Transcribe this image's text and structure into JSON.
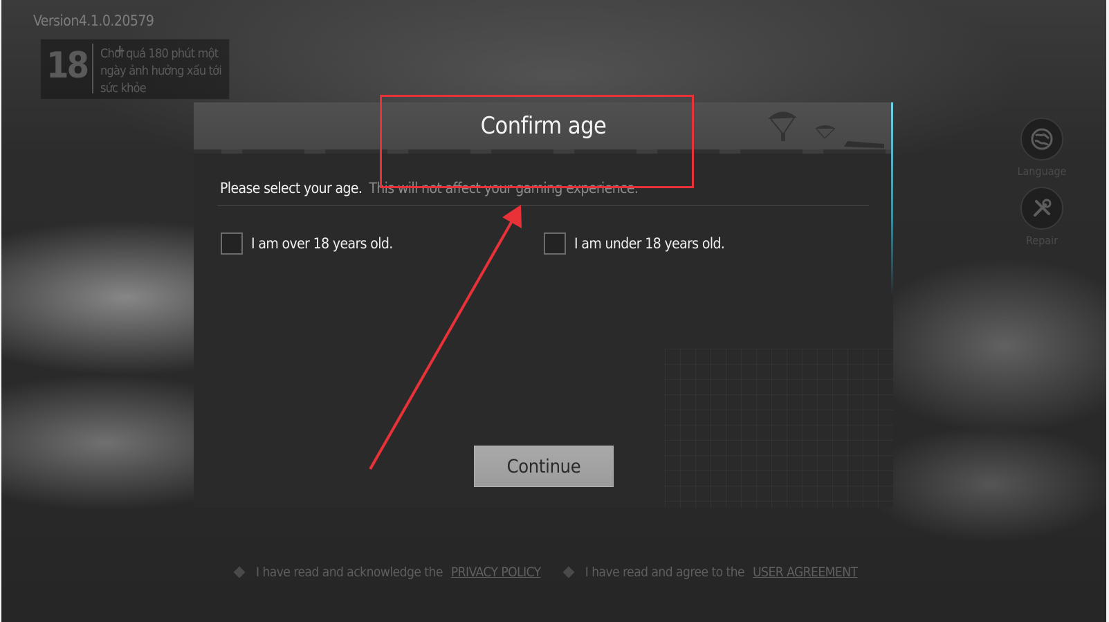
{
  "version": "Version4.1.0.20579",
  "age_notice": {
    "rating": "18",
    "plus": "+",
    "text": "Chơi quá 180 phút một ngày ảnh hưởng xấu tới sức khỏe"
  },
  "side_buttons": {
    "language": "Language",
    "repair": "Repair"
  },
  "dialog": {
    "title": "Confirm age",
    "prompt": "Please select your age.",
    "prompt_note": "This will not affect your gaming experience.",
    "option_over": "I am over 18 years old.",
    "option_under": "I am under 18 years old.",
    "continue_label": "Continue"
  },
  "footer": {
    "privacy_prefix": "I have read and acknowledge the",
    "privacy_link": "PRIVACY POLICY",
    "agreement_prefix": "I have read and agree to the",
    "agreement_link": "USER AGREEMENT"
  },
  "colors": {
    "annotation": "#e83238",
    "accent_edge": "#6fd3e6"
  }
}
